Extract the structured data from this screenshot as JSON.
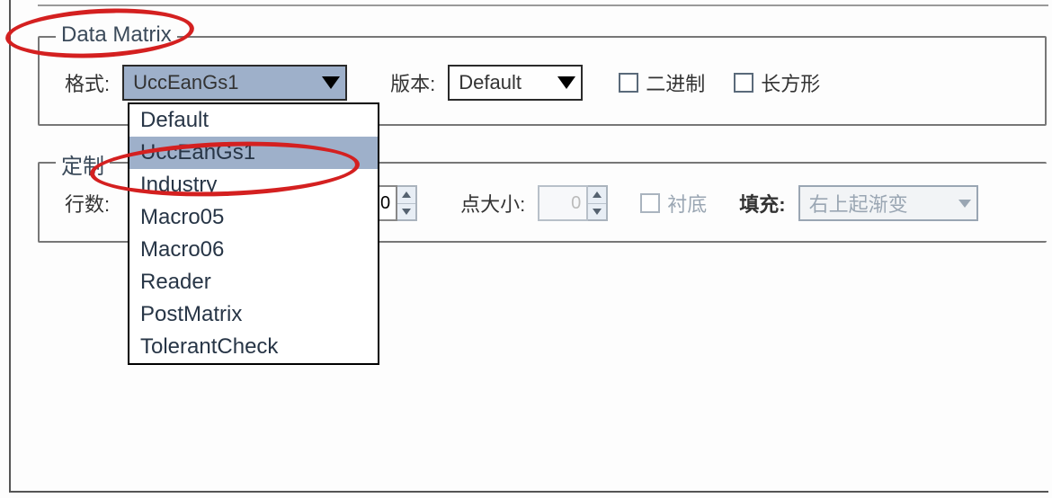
{
  "datamatrix": {
    "title": "Data Matrix",
    "format_label": "格式:",
    "format_value": "UccEanGs1",
    "format_options": [
      "Default",
      "UccEanGs1",
      "Industry",
      "Macro05",
      "Macro06",
      "Reader",
      "PostMatrix",
      "TolerantCheck"
    ],
    "format_open": true,
    "format_selected_index": 1,
    "version_label": "版本:",
    "version_value": "Default",
    "binary_label": "二进制",
    "rect_label": "长方形"
  },
  "custom": {
    "title": "定制",
    "rows_label": "行数:",
    "rows_value": "0",
    "dotsize_label": "点大小:",
    "dotsize_value": "0",
    "underlay_label": "衬底",
    "fill_label": "填充:",
    "fill_value": "右上起渐变"
  }
}
